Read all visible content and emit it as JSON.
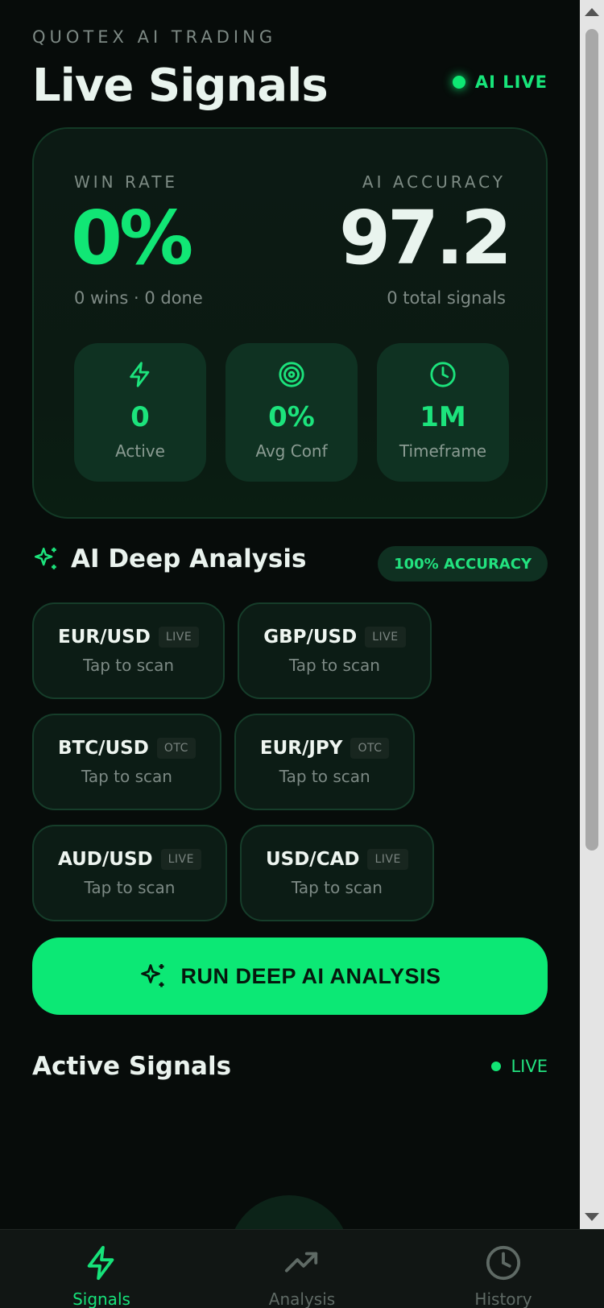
{
  "header": {
    "kicker": "QUOTEX AI TRADING",
    "title": "Live Signals",
    "status": "AI LIVE"
  },
  "stats": {
    "win_rate_label": "WIN RATE",
    "win_rate_value": "0%",
    "win_rate_sub": "0 wins · 0 done",
    "accuracy_label": "AI ACCURACY",
    "accuracy_value": "97.2",
    "accuracy_sub": "0 total signals",
    "tiles": [
      {
        "icon": "bolt-icon",
        "value": "0",
        "label": "Active"
      },
      {
        "icon": "target-icon",
        "value": "0%",
        "label": "Avg Conf"
      },
      {
        "icon": "clock-icon",
        "value": "1M",
        "label": "Timeframe"
      }
    ]
  },
  "analysis": {
    "title": "AI Deep Analysis",
    "badge": "100% ACCURACY",
    "pairs": [
      {
        "symbol": "EUR/USD",
        "tag": "LIVE",
        "hint": "Tap to scan"
      },
      {
        "symbol": "GBP/USD",
        "tag": "LIVE",
        "hint": "Tap to scan"
      },
      {
        "symbol": "BTC/USD",
        "tag": "OTC",
        "hint": "Tap to scan"
      },
      {
        "symbol": "EUR/JPY",
        "tag": "OTC",
        "hint": "Tap to scan"
      },
      {
        "symbol": "AUD/USD",
        "tag": "LIVE",
        "hint": "Tap to scan"
      },
      {
        "symbol": "USD/CAD",
        "tag": "LIVE",
        "hint": "Tap to scan"
      }
    ],
    "run_button": "RUN DEEP AI ANALYSIS"
  },
  "active_signals": {
    "title": "Active Signals",
    "status": "LIVE"
  },
  "nav": [
    {
      "label": "Signals",
      "icon": "bolt-icon",
      "active": true
    },
    {
      "label": "Analysis",
      "icon": "trend-up-icon",
      "active": false
    },
    {
      "label": "History",
      "icon": "clock-icon",
      "active": false
    }
  ],
  "colors": {
    "accent": "#0ce875",
    "background": "#070c0a",
    "card": "#0c1a14",
    "tile": "#0f3222"
  }
}
